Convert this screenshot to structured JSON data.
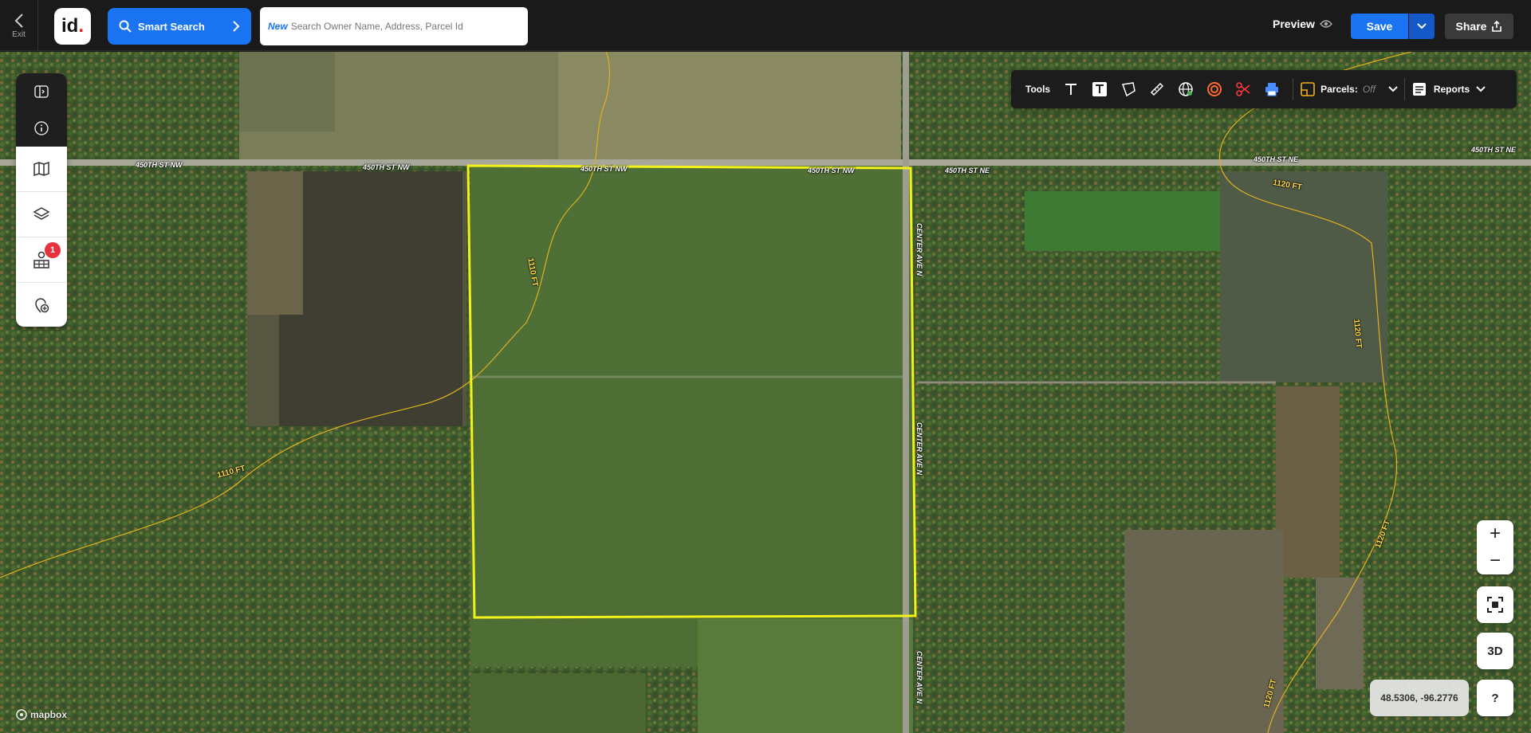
{
  "topbar": {
    "exit_label": "Exit",
    "logo_text": "id",
    "smart_search_label": "Smart Search",
    "search_new_label": "New",
    "search_placeholder": "Search Owner Name, Address, Parcel Id",
    "search_value": "",
    "preview_label": "Preview",
    "save_label": "Save",
    "share_label": "Share"
  },
  "left_panel": {
    "items": [
      {
        "icon": "collapse-panel-icon"
      },
      {
        "icon": "info-icon"
      },
      {
        "icon": "map-icon"
      },
      {
        "icon": "layers-icon"
      },
      {
        "icon": "buildings-pin-icon",
        "badge": "1"
      },
      {
        "icon": "add-location-icon"
      }
    ]
  },
  "tools": {
    "label": "Tools",
    "items": [
      "text-icon",
      "text-box-icon",
      "polygon-icon",
      "ruler-icon",
      "globe-icon",
      "target-icon",
      "scissors-icon",
      "print-icon"
    ],
    "parcels_label": "Parcels:",
    "parcels_state": "Off",
    "reports_label": "Reports"
  },
  "map": {
    "road_labels": [
      "450TH ST NW",
      "450TH ST NW",
      "450TH ST NW",
      "450TH ST NW",
      "450TH ST NE",
      "450TH ST NE",
      "450TH ST NE",
      "CENTER AVE N",
      "CENTER AVE N",
      "CENTER AVE N"
    ],
    "contour_labels": [
      "1110 FT",
      "1110 FT",
      "1120 FT",
      "1120 FT",
      "1120 FT",
      "1120 FT"
    ],
    "selection_color": "#f2f21a",
    "contour_color": "#e0b020",
    "attribution": "mapbox"
  },
  "controls": {
    "zoom_in": "+",
    "zoom_out": "−",
    "three_d": "3D",
    "help": "?",
    "coordinates": "48.5306, -96.2776"
  }
}
